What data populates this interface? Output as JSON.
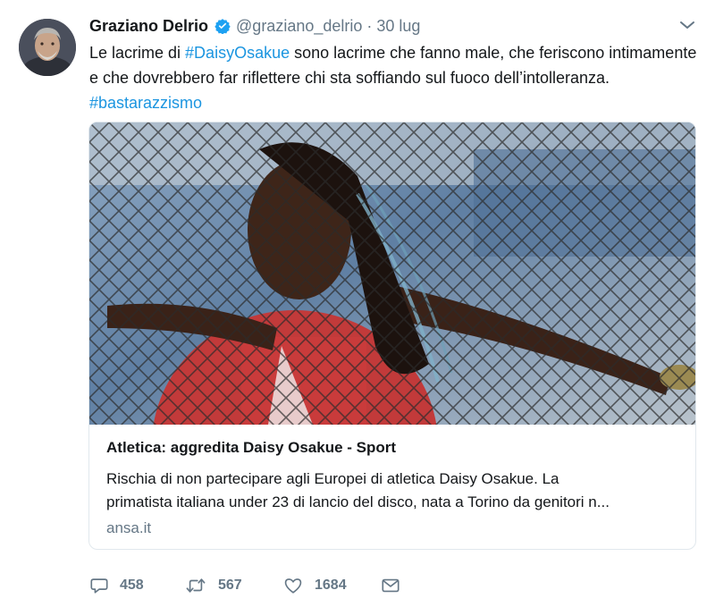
{
  "tweet": {
    "author_name": "Graziano Delrio",
    "handle": "@graziano_delrio",
    "separator": "·",
    "date": "30 lug",
    "text_before_1": "Le lacrime di ",
    "hashtag_1": "#DaisyOsakue",
    "text_after_1": " sono lacrime che fanno male, che feriscono intimamente e che dovrebbero far riflettere chi sta soffiando sul fuoco dell’intolleranza. ",
    "hashtag_2": "#bastarazzismo"
  },
  "card": {
    "title": "Atletica: aggredita Daisy Osakue - Sport",
    "description_line_1": "Rischia di non partecipare agli Europei di atletica Daisy Osakue. La",
    "description_line_2": "primatista italiana under 23 di lancio del disco, nata a Torino da genitori n...",
    "domain": "ansa.it"
  },
  "actions": {
    "replies": "458",
    "retweets": "567",
    "likes": "1684"
  },
  "colors": {
    "link": "#1b95e0",
    "verified": "#1da1f2",
    "muted": "#657786",
    "text": "#14171a",
    "border": "#e1e8ed"
  },
  "icons": [
    "verified-badge-icon",
    "chevron-down-icon",
    "reply-icon",
    "retweet-icon",
    "like-icon",
    "direct-message-icon"
  ]
}
